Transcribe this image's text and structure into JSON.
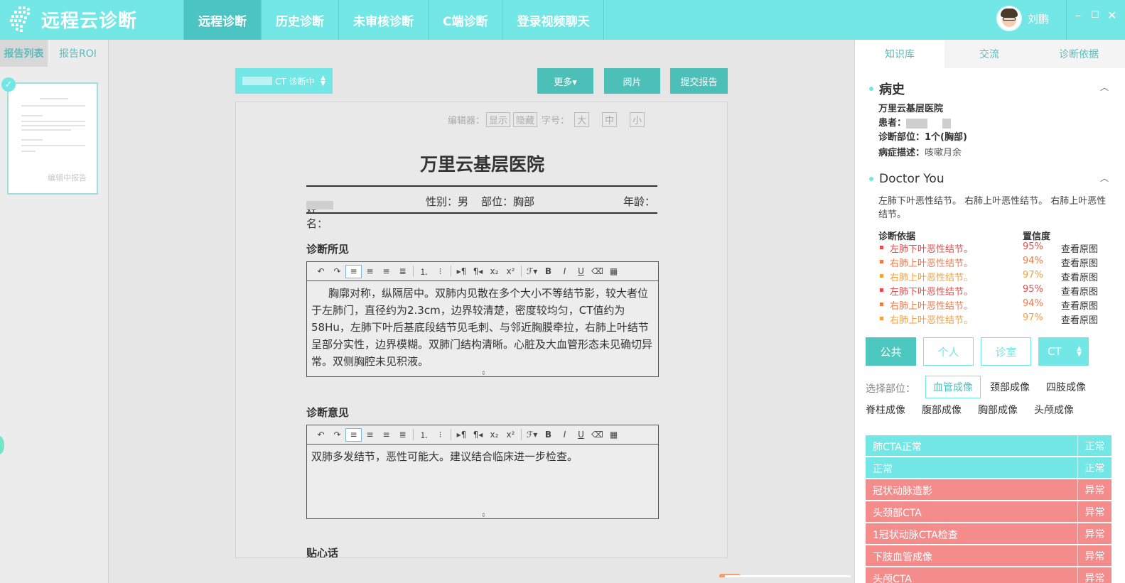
{
  "app": {
    "title": "远程云诊断"
  },
  "nav": [
    {
      "label": "远程诊断",
      "active": true
    },
    {
      "label": "历史诊断",
      "active": false
    },
    {
      "label": "未审核诊断",
      "active": false
    },
    {
      "label": "C端诊断",
      "active": false
    },
    {
      "label": "登录视频聊天",
      "active": false
    }
  ],
  "user": {
    "name": "刘鹏"
  },
  "window": {
    "minimize": "–",
    "maximize": "☐",
    "close": "✕"
  },
  "left": {
    "tabs": [
      "报告列表",
      "报告ROI"
    ],
    "thumb_label": "编辑中报告"
  },
  "center": {
    "status_select": "CT 诊断中",
    "buttons": {
      "more": "更多▾",
      "read": "阅片",
      "submit": "提交报告"
    },
    "editor_bar": {
      "label": "编辑器：",
      "show": "显示",
      "hide": "隐藏",
      "font_label": "字号：",
      "large": "大",
      "medium": "中",
      "small": "小"
    },
    "hospital": "万里云基层医院",
    "patient": {
      "name_label": "姓名：",
      "gender": "性别：男",
      "part": "部位：胸部",
      "age_label": "年龄："
    },
    "findings": {
      "title": "诊断所见",
      "text": "胸廓对称，纵隔居中。双肺内见散在多个大小不等结节影，较大者位于左肺门，直径约为2.3cm，边界较清楚，密度较均匀，CT值约为58Hu，左肺下叶后基底段结节见毛刺、与邻近胸膜牵拉，右肺上叶结节呈部分实性，边界模糊。双肺门结构清晰。心脏及大血管形态未见确切异常。双侧胸腔未见积液。"
    },
    "opinion": {
      "title": "诊断意见",
      "text": "双肺多发结节，恶性可能大。建议结合临床进一步检查。"
    },
    "tip_title": "贴心话"
  },
  "right": {
    "tabs": [
      "知识库",
      "交流",
      "诊断依据"
    ],
    "history": {
      "title": "病史",
      "hospital": "万里云基层医院",
      "patient_label": "患者：",
      "part_label": "诊断部位：",
      "part_value": "1个(胸部)",
      "symptom_label": "病症描述：",
      "symptom_value": "咳嗽月余"
    },
    "doctor": {
      "title": "Doctor You",
      "summary": "左肺下叶恶性结节。 右肺上叶恶性结节。 右肺上叶恶性结节。",
      "basis_label": "诊断依据",
      "conf_label": "置信度",
      "items": [
        {
          "name": "左肺下叶恶性结节。",
          "pct": "95%",
          "view": "查看原图",
          "color": "#e84c4c"
        },
        {
          "name": "右肺上叶恶性结节。",
          "pct": "94%",
          "view": "查看原图",
          "color": "#f07a4a"
        },
        {
          "name": "右肺上叶恶性结节。",
          "pct": "97%",
          "view": "查看原图",
          "color": "#f4a040"
        },
        {
          "name": "左肺下叶恶性结节。",
          "pct": "95%",
          "view": "查看原图",
          "color": "#e84c4c"
        },
        {
          "name": "右肺上叶恶性结节。",
          "pct": "94%",
          "view": "查看原图",
          "color": "#f07a4a"
        },
        {
          "name": "右肺上叶恶性结节。",
          "pct": "97%",
          "view": "查看原图",
          "color": "#f4a040"
        }
      ]
    },
    "filters": [
      "公共",
      "个人",
      "诊室"
    ],
    "modality": "CT",
    "part_select_label": "选择部位：",
    "parts": [
      "血管成像",
      "颈部成像",
      "四肢成像",
      "脊柱成像",
      "腹部成像",
      "胸部成像",
      "头颅成像"
    ],
    "results": [
      {
        "name": "肺CTA正常",
        "status": "正常",
        "ok": true
      },
      {
        "name": "正常",
        "status": "正常",
        "ok": true
      },
      {
        "name": "冠状动脉造影",
        "status": "异常",
        "ok": false
      },
      {
        "name": "头颈部CTA",
        "status": "异常",
        "ok": false
      },
      {
        "name": "1冠状动脉CTA检查",
        "status": "异常",
        "ok": false
      },
      {
        "name": "下肢血管成像",
        "status": "异常",
        "ok": false
      },
      {
        "name": "头颅CTA",
        "status": "异常",
        "ok": false
      }
    ]
  }
}
